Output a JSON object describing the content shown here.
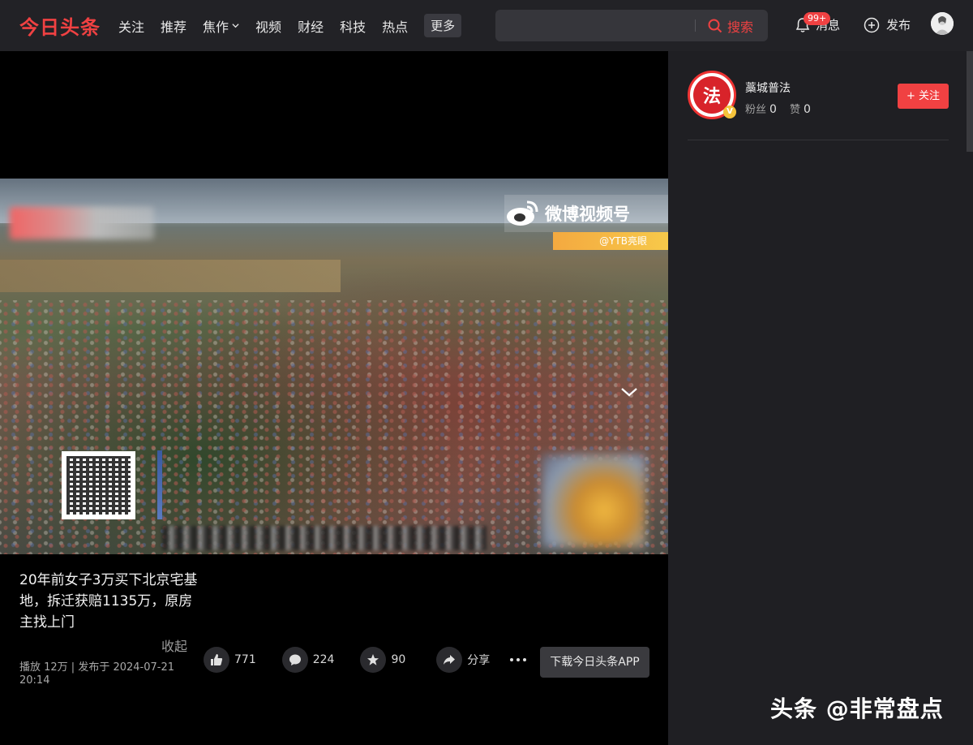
{
  "header": {
    "logo": "今日头条",
    "nav": [
      "关注",
      "推荐",
      "焦作",
      "视频",
      "财经",
      "科技",
      "热点"
    ],
    "more": "更多",
    "search_placeholder": "",
    "search_button": "搜索",
    "notifications_label": "消息",
    "notifications_badge": "99+",
    "publish_label": "发布"
  },
  "video": {
    "overlay_brand": "微博视频号",
    "overlay_handle": "@YTB亮眼"
  },
  "post": {
    "title": "20年前女子3万买下北京宅基地，拆迁获赔1135万，原房主找上门",
    "fold_label": "收起",
    "meta": "播放 12万 | 发布于 2024-07-21 20:14"
  },
  "actions": {
    "likes": "771",
    "comments": "224",
    "favorites": "90",
    "share_label": "分享",
    "download_label": "下载今日头条APP"
  },
  "author": {
    "name": "藁城普法",
    "avatar_glyph": "法",
    "fans_label": "粉丝",
    "fans": "0",
    "likes_label": "赞",
    "likes": "0",
    "follow_label": "关注",
    "verified_glyph": "V"
  },
  "watermark": "头条 @非常盘点",
  "colors": {
    "brand": "#f04142",
    "topbar": "#222226",
    "sidebar": "#1f1f23"
  }
}
